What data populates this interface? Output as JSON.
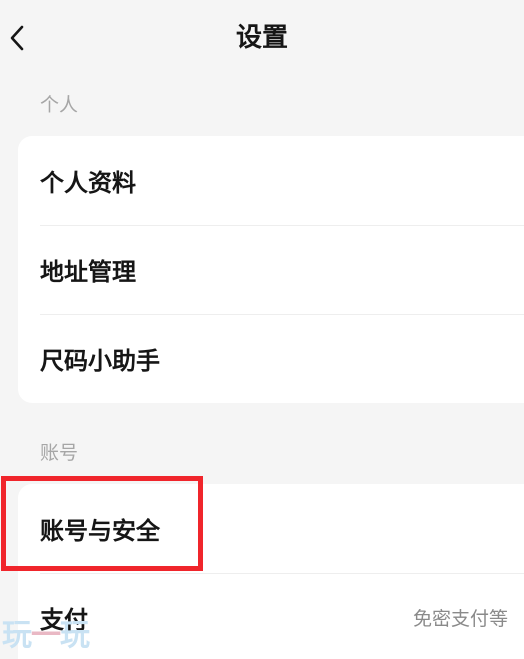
{
  "header": {
    "title": "设置",
    "back_icon": "chevron-left-icon"
  },
  "sections": [
    {
      "label": "个人",
      "items": [
        {
          "label": "个人资料"
        },
        {
          "label": "地址管理"
        },
        {
          "label": "尺码小助手"
        }
      ]
    },
    {
      "label": "账号",
      "items": [
        {
          "label": "账号与安全"
        },
        {
          "label": "支付",
          "value": "免密支付等"
        }
      ]
    }
  ],
  "annotation": {
    "highlight_color": "#f0252b",
    "highlighted_item": "账号与安全"
  },
  "watermark": {
    "text_part1": "玩",
    "text_part2": "一",
    "text_part3": "玩"
  }
}
